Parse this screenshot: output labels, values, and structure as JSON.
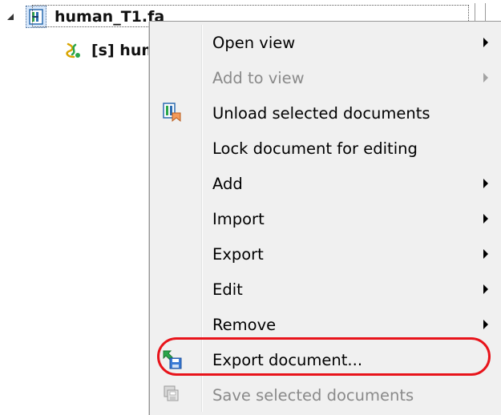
{
  "tree": {
    "root_label": "human_T1.fa",
    "child_label": "[s] hum"
  },
  "menu": {
    "items": [
      {
        "label": "Open view",
        "enabled": true,
        "submenu": true,
        "icon": ""
      },
      {
        "label": "Add to view",
        "enabled": false,
        "submenu": true,
        "icon": ""
      },
      {
        "label": "Unload selected documents",
        "enabled": true,
        "submenu": false,
        "icon": "unload-documents-icon"
      },
      {
        "label": "Lock document for editing",
        "enabled": true,
        "submenu": false,
        "icon": ""
      },
      {
        "label": "Add",
        "enabled": true,
        "submenu": true,
        "icon": ""
      },
      {
        "label": "Import",
        "enabled": true,
        "submenu": true,
        "icon": ""
      },
      {
        "label": "Export",
        "enabled": true,
        "submenu": true,
        "icon": ""
      },
      {
        "label": "Edit",
        "enabled": true,
        "submenu": true,
        "icon": ""
      },
      {
        "label": "Remove",
        "enabled": true,
        "submenu": true,
        "icon": ""
      },
      {
        "label": "Export document...",
        "enabled": true,
        "submenu": false,
        "icon": "export-document-icon"
      },
      {
        "label": "Save selected documents",
        "enabled": false,
        "submenu": false,
        "icon": "save-documents-icon"
      }
    ]
  },
  "colors": {
    "menu_background": "#f0f0f0",
    "highlight_ring": "#e8141b",
    "selection_fill": "#d8e8fb"
  }
}
